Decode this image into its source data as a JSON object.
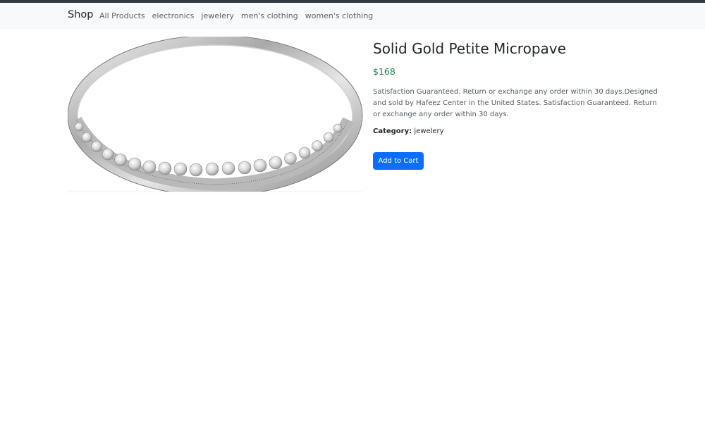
{
  "navbar": {
    "brand": "Shop",
    "links": [
      {
        "label": "All Products"
      },
      {
        "label": "electronics"
      },
      {
        "label": "jewelery"
      },
      {
        "label": "men's clothing"
      },
      {
        "label": "women's clothing"
      }
    ]
  },
  "product": {
    "title": "Solid Gold Petite Micropave",
    "price": "$168",
    "description": "Satisfaction Guaranteed. Return or exchange any order within 30 days.Designed and sold by Hafeez Center in the United States. Satisfaction Guaranteed. Return or exchange any order within 30 days.",
    "category_label": "Category:",
    "category_value": "jewelery",
    "add_to_cart_label": "Add to Cart"
  },
  "colors": {
    "navbar_bg": "#f8f9fa",
    "price": "#198754",
    "button": "#0d6efd"
  }
}
